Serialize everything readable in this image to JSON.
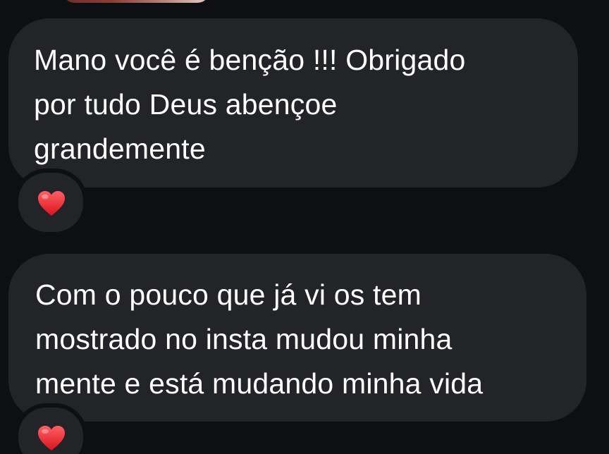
{
  "messages": [
    {
      "text": "Mano você é benção !!! Obrigado\npor tudo Deus abençoe\ngrandemente",
      "reaction_icon": "heart-icon"
    },
    {
      "text": "Com o pouco que já vi os tem\nmostrado no insta mudou minha\nmente e está mudando minha vida",
      "reaction_icon": "heart-icon"
    }
  ],
  "colors": {
    "background": "#0d0f12",
    "bubble": "#232428",
    "text": "#ffffff",
    "heart": "#e0242d"
  }
}
